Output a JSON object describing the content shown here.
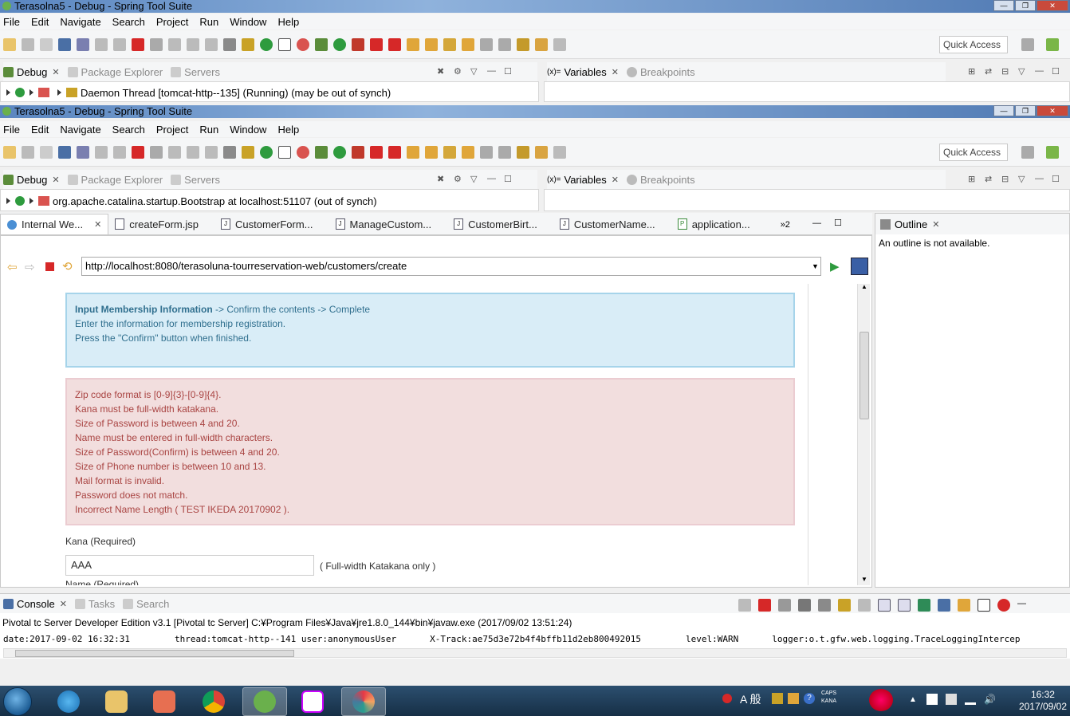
{
  "window1": {
    "title": "Terasolna5 - Debug - Spring Tool Suite",
    "menu": [
      "File",
      "Edit",
      "Navigate",
      "Search",
      "Project",
      "Run",
      "Window",
      "Help"
    ],
    "quick_access": "Quick Access",
    "views": {
      "debug": "Debug",
      "package_explorer": "Package Explorer",
      "servers": "Servers",
      "variables": "Variables",
      "breakpoints": "Breakpoints"
    },
    "thread": "Daemon Thread [tomcat-http--135] (Running) (may be out of synch)"
  },
  "window2": {
    "title": "Terasolna5 - Debug - Spring Tool Suite",
    "menu": [
      "File",
      "Edit",
      "Navigate",
      "Search",
      "Project",
      "Run",
      "Window",
      "Help"
    ],
    "quick_access": "Quick Access",
    "views": {
      "debug": "Debug",
      "package_explorer": "Package Explorer",
      "servers": "Servers",
      "variables": "Variables",
      "breakpoints": "Breakpoints"
    },
    "thread": "org.apache.catalina.startup.Bootstrap at localhost:51107 (out of synch)"
  },
  "editor_tabs": [
    {
      "label": "Internal We...",
      "active": true
    },
    {
      "label": "createForm.jsp"
    },
    {
      "label": "CustomerForm..."
    },
    {
      "label": "ManageCustom..."
    },
    {
      "label": "CustomerBirt..."
    },
    {
      "label": "CustomerName..."
    },
    {
      "label": "application..."
    }
  ],
  "overflow_tabs": "»2",
  "browser": {
    "url": "http://localhost:8080/terasoluna-tourreservation-web/customers/create"
  },
  "page": {
    "steps": {
      "current": "Input Membership Information",
      "rest": " -> Confirm the contents -> Complete"
    },
    "info_lines": [
      "Enter the information for membership registration.",
      "Press the \"Confirm\" button when finished."
    ],
    "errors": [
      "Zip code format is [0-9]{3}-[0-9]{4}.",
      "Kana must be full-width katakana.",
      "Size of Password is between 4 and 20.",
      "Name must be entered in full-width characters.",
      "Size of Password(Confirm) is between 4 and 20.",
      "Size of Phone number is between 10 and 13.",
      "Mail format is invalid.",
      "Password does not match.",
      "Incorrect Name Length ( TEST IKEDA 20170902 )."
    ],
    "kana_label": "Kana (Required)",
    "kana_value": "AAA",
    "kana_hint": "( Full-width Katakana only )",
    "next_label": "Name (Required)"
  },
  "outline": {
    "title": "Outline",
    "message": "An outline is not available."
  },
  "console": {
    "tabs": {
      "console": "Console",
      "tasks": "Tasks",
      "search": "Search"
    },
    "process": "Pivotal tc Server Developer Edition v3.1 [Pivotal tc Server] C:¥Program Files¥Java¥jre1.8.0_144¥bin¥javaw.exe (2017/09/02 13:51:24)",
    "log": {
      "date": "date:2017-09-02 16:32:31",
      "thread": "thread:tomcat-http--141",
      "user": "user:anonymousUser",
      "track": "X-Track:ae75d3e72b4f4bffb11d2eb800492015",
      "level": "level:WARN",
      "logger": "logger:o.t.gfw.web.logging.TraceLoggingIntercep"
    }
  },
  "taskbar": {
    "ime": "A 般",
    "caps": "CAPS",
    "kana": "KANA",
    "time": "16:32",
    "date": "2017/09/02"
  }
}
